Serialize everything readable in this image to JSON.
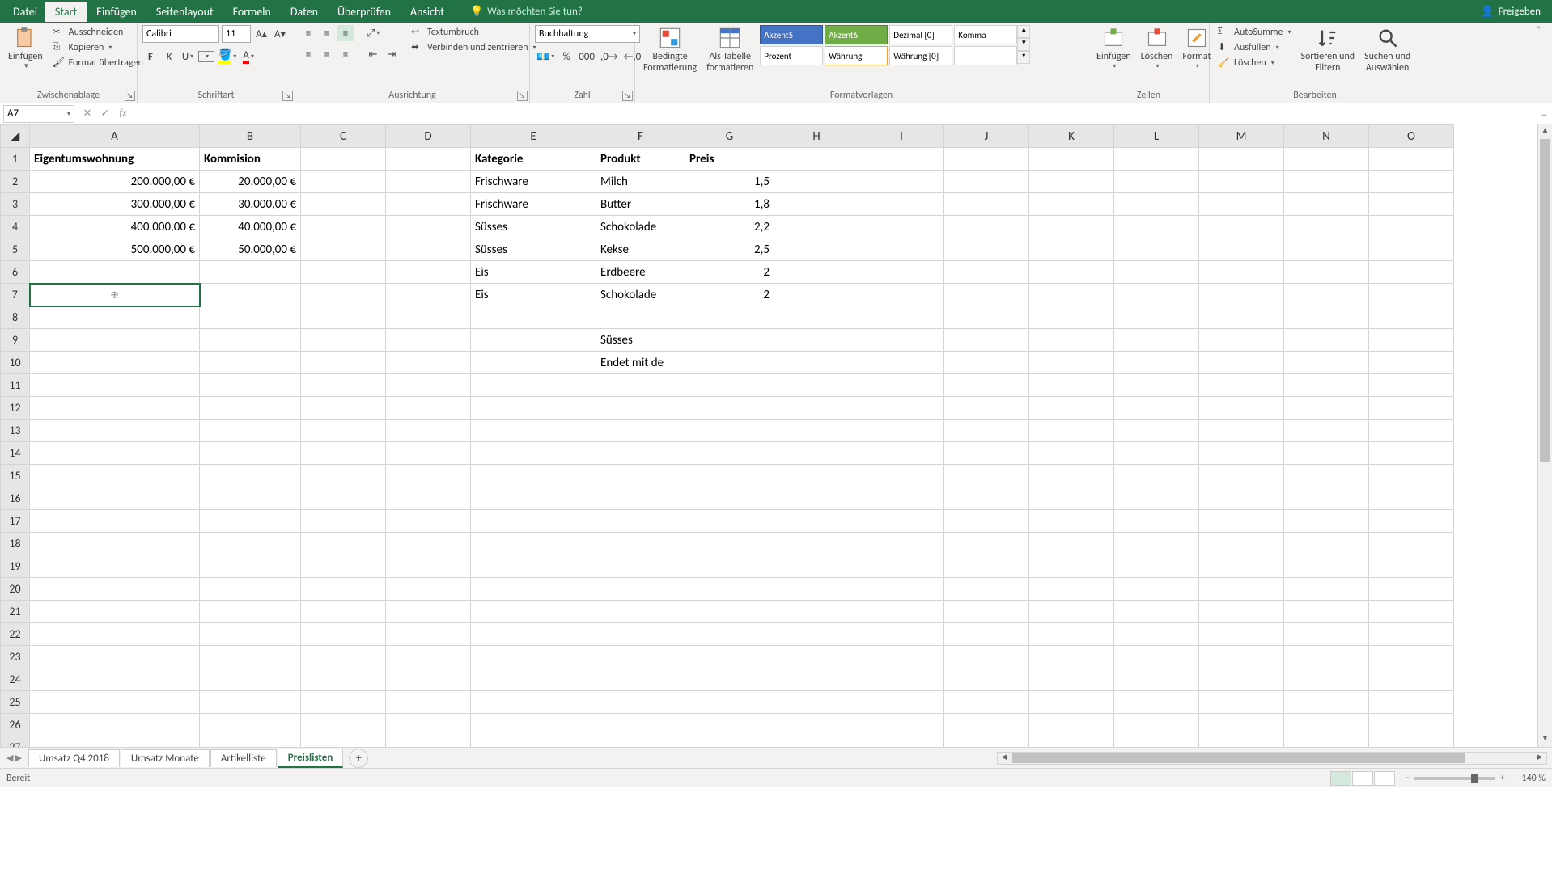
{
  "titlebar": {
    "file": "Datei",
    "tabs": [
      "Start",
      "Einfügen",
      "Seitenlayout",
      "Formeln",
      "Daten",
      "Überprüfen",
      "Ansicht"
    ],
    "active_tab": "Start",
    "search_placeholder": "Was möchten Sie tun?",
    "share": "Freigeben"
  },
  "ribbon": {
    "paste": "Einfügen",
    "cut": "Ausschneiden",
    "copy": "Kopieren",
    "format_painter": "Format übertragen",
    "clipboard_label": "Zwischenablage",
    "font_name": "Calibri",
    "font_size": "11",
    "font_label": "Schriftart",
    "wrap_text": "Textumbruch",
    "merge_center": "Verbinden und zentrieren",
    "alignment_label": "Ausrichtung",
    "number_format": "Buchhaltung",
    "number_label": "Zahl",
    "cond_format": "Bedingte\nFormatierung",
    "as_table": "Als Tabelle\nformatieren",
    "style_akzent5": "Akzent5",
    "style_akzent6": "Akzent6",
    "style_dezimal": "Dezimal [0]",
    "style_komma": "Komma",
    "style_prozent": "Prozent",
    "style_waehrung": "Währung",
    "style_waehrung0": "Währung [0]",
    "styles_label": "Formatvorlagen",
    "insert": "Einfügen",
    "delete": "Löschen",
    "format": "Format",
    "cells_label": "Zellen",
    "autosum": "AutoSumme",
    "fill": "Ausfüllen",
    "clear": "Löschen",
    "sort_filter": "Sortieren und\nFiltern",
    "find_select": "Suchen und\nAuswählen",
    "editing_label": "Bearbeiten"
  },
  "formula_bar": {
    "cell_ref": "A7",
    "formula": ""
  },
  "columns": [
    "A",
    "B",
    "C",
    "D",
    "E",
    "F",
    "G",
    "H",
    "I",
    "J",
    "K",
    "L",
    "M",
    "N",
    "O"
  ],
  "grid": {
    "headers": {
      "A1": "Eigentumswohnung",
      "B1": "Kommision",
      "E1": "Kategorie",
      "F1": "Produkt",
      "G1": "Preis"
    },
    "rows": [
      {
        "A": "200.000,00 €",
        "B": "20.000,00 €",
        "E": "Frischware",
        "F": "Milch",
        "G": "1,5"
      },
      {
        "A": "300.000,00 €",
        "B": "30.000,00 €",
        "E": "Frischware",
        "F": "Butter",
        "G": "1,8"
      },
      {
        "A": "400.000,00 €",
        "B": "40.000,00 €",
        "E": "Süsses",
        "F": "Schokolade",
        "G": "2,2"
      },
      {
        "A": "500.000,00 €",
        "B": "50.000,00 €",
        "E": "Süsses",
        "F": "Kekse",
        "G": "2,5"
      },
      {
        "A": "",
        "B": "",
        "E": "Eis",
        "F": "Erdbeere",
        "G": "2"
      },
      {
        "A": "",
        "B": "",
        "E": "Eis",
        "F": "Schokolade",
        "G": "2"
      }
    ],
    "F9": "Süsses",
    "F10": "Endet mit de"
  },
  "sheets": {
    "tabs": [
      "Umsatz Q4 2018",
      "Umsatz Monate",
      "Artikelliste",
      "Preislisten"
    ],
    "active": "Preislisten"
  },
  "status": {
    "ready": "Bereit",
    "zoom": "140 %"
  }
}
